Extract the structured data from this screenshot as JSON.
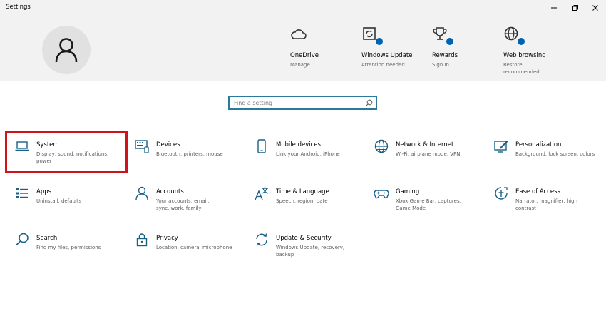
{
  "window": {
    "title": "Settings",
    "controls": [
      "minimize",
      "maximize",
      "close"
    ]
  },
  "search": {
    "placeholder": "Find a setting"
  },
  "quick_links": [
    {
      "title": "OneDrive",
      "subtitle": "Manage",
      "icon": "cloud-icon",
      "badge": false
    },
    {
      "title": "Windows Update",
      "subtitle": "Attention needed",
      "icon": "update-icon",
      "badge": true
    },
    {
      "title": "Rewards",
      "subtitle": "Sign In",
      "icon": "trophy-icon",
      "badge": true
    },
    {
      "title": "Web browsing",
      "subtitle": "Restore recommended",
      "icon": "globe-icon",
      "badge": true
    }
  ],
  "categories": [
    {
      "name": "System",
      "desc": "Display, sound, notifications, power",
      "icon": "laptop-icon"
    },
    {
      "name": "Devices",
      "desc": "Bluetooth, printers, mouse",
      "icon": "keyboard-icon"
    },
    {
      "name": "Mobile devices",
      "desc": "Link your Android, iPhone",
      "icon": "phone-icon"
    },
    {
      "name": "Network & Internet",
      "desc": "Wi-Fi, airplane mode, VPN",
      "icon": "globe-icon"
    },
    {
      "name": "Personalization",
      "desc": "Background, lock screen, colors",
      "icon": "paint-icon"
    },
    {
      "name": "Apps",
      "desc": "Uninstall, defaults",
      "icon": "apps-list-icon"
    },
    {
      "name": "Accounts",
      "desc": "Your accounts, email, sync, work, family",
      "icon": "person-icon"
    },
    {
      "name": "Time & Language",
      "desc": "Speech, region, date",
      "icon": "language-icon"
    },
    {
      "name": "Gaming",
      "desc": "Xbox Game Bar, captures, Game Mode",
      "icon": "gamepad-icon"
    },
    {
      "name": "Ease of Access",
      "desc": "Narrator, magnifier, high contrast",
      "icon": "ease-of-access-icon"
    },
    {
      "name": "Search",
      "desc": "Find my files, permissions",
      "icon": "search-icon"
    },
    {
      "name": "Privacy",
      "desc": "Location, camera, microphone",
      "icon": "lock-icon"
    },
    {
      "name": "Update & Security",
      "desc": "Windows Update, recovery, backup",
      "icon": "sync-icon"
    }
  ],
  "colors": {
    "accent": "#0063b1",
    "icon": "#1a5f86",
    "highlight_border": "#d0121b",
    "header_bg": "#f2f2f2"
  }
}
